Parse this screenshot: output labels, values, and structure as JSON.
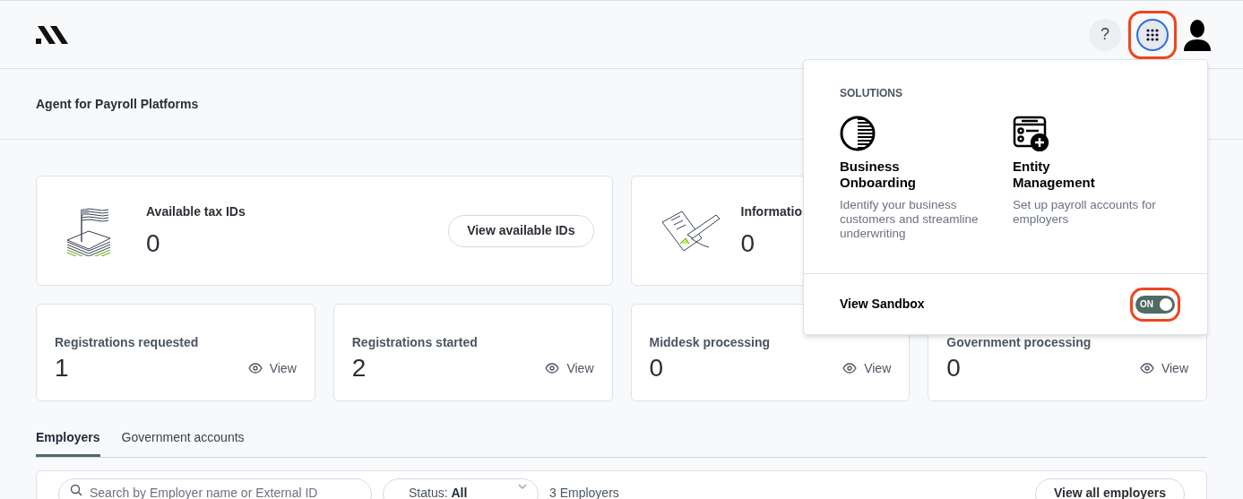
{
  "header": {
    "help_label": "?",
    "apps_menu_open": true
  },
  "page_title": "Agent for Payroll Platforms",
  "summary_cards": [
    {
      "kind": "tax",
      "label": "Available tax IDs",
      "value": "0",
      "button": "View available IDs"
    },
    {
      "kind": "info",
      "label": "Informatio",
      "value": "0"
    }
  ],
  "status_cards": [
    {
      "label": "Registrations requested",
      "value": "1",
      "action": "View"
    },
    {
      "label": "Registrations started",
      "value": "2",
      "action": "View"
    },
    {
      "label": "Middesk processing",
      "value": "0",
      "action": "View"
    },
    {
      "label": "Government processing",
      "value": "0",
      "action": "View"
    }
  ],
  "tabs": [
    {
      "label": "Employers",
      "selected": true
    },
    {
      "label": "Government accounts",
      "selected": false
    }
  ],
  "toolbar": {
    "search_placeholder": "Search by Employer name or External ID",
    "status_label": "Status:",
    "status_value": "All",
    "count": "3 Employers",
    "button": "View all employers"
  },
  "solutions_menu": {
    "heading": "SOLUTIONS",
    "items": [
      {
        "kind": "onboarding",
        "title": "Business Onboarding",
        "description": "Identify your business customers and streamline underwriting"
      },
      {
        "kind": "entity",
        "title": "Entity Management",
        "description": "Set up payroll accounts for employers"
      }
    ],
    "sandbox": {
      "label": "View Sandbox",
      "toggle_label": "ON",
      "on": true
    }
  }
}
